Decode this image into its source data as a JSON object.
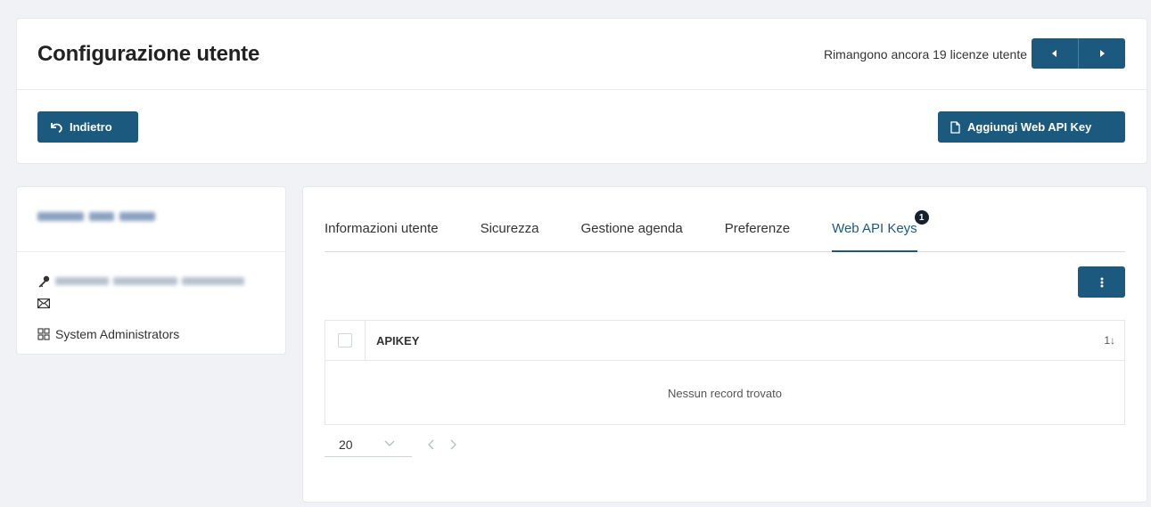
{
  "header": {
    "title": "Configurazione utente",
    "license_text": "Rimangono ancora 19 licenze utente"
  },
  "toolbar": {
    "back_label": "Indietro",
    "add_key_label": "Aggiungi Web API Key"
  },
  "profile": {
    "group": "System Administrators",
    "icons": [
      "key-icon",
      "mail-icon",
      "group-icon"
    ]
  },
  "tabs": [
    {
      "label": "Informazioni utente"
    },
    {
      "label": "Sicurezza"
    },
    {
      "label": "Gestione agenda"
    },
    {
      "label": "Preferenze"
    },
    {
      "label": "Web API Keys",
      "badge": "1",
      "active": true
    }
  ],
  "grid": {
    "columns": [
      "APIKEY"
    ],
    "sort_indicator": "1↓",
    "empty_message": "Nessun record trovato",
    "page_size": "20"
  },
  "colors": {
    "primary": "#1b5a7e",
    "badge": "#16202c"
  }
}
